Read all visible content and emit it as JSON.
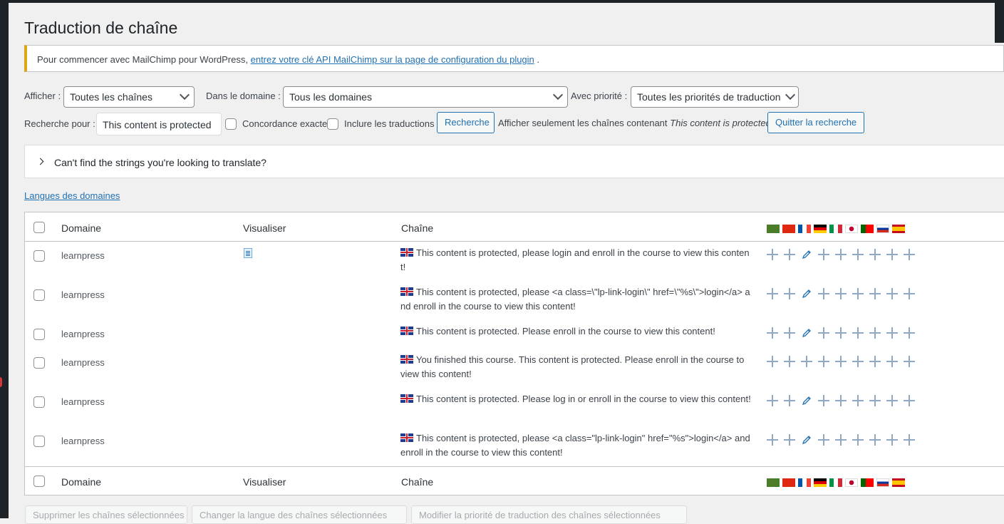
{
  "page": {
    "title": "Traduction de chaîne"
  },
  "notice": {
    "text": "Pour commencer avec MailChimp pour WordPress,",
    "link": "entrez votre clé API MailChimp sur la page de configuration du plugin",
    "suffix": "."
  },
  "filters": {
    "afficher_label": "Afficher :",
    "afficher_value": "Toutes les chaînes",
    "domaine_label": "Dans le domaine :",
    "domaine_value": "Tous les domaines",
    "priorite_label": "Avec priorité :",
    "priorite_value": "Toutes les priorités de traduction",
    "recherche_label": "Recherche pour :",
    "recherche_value": "This content is protected",
    "concordance_label": "Concordance exacte",
    "inclure_label": "Inclure les traductions",
    "recherche_button": "Recherche",
    "show_only_text": "Afficher seulement les chaînes contenant",
    "show_only_term": "This content is protected",
    "quit_button": "Quitter la recherche"
  },
  "accordion": {
    "text": "Can't find the strings you're looking to translate?"
  },
  "langues_link": "Langues des domaines",
  "table": {
    "col_domaine": "Domaine",
    "col_visualiser": "Visualiser",
    "col_chaine": "Chaîne",
    "flags": [
      "ar",
      "zh",
      "fr",
      "de",
      "it",
      "ja",
      "pt",
      "ru",
      "es"
    ],
    "rows": [
      {
        "domaine": "learnpress",
        "has_view": true,
        "chaine": "This content is protected, please login and enroll in the course to view this content!",
        "actions": [
          "plus",
          "plus",
          "pencil",
          "plus",
          "plus",
          "plus",
          "plus",
          "plus",
          "plus"
        ]
      },
      {
        "domaine": "learnpress",
        "has_view": false,
        "chaine": "This content is protected, please <a class=\\\"lp-link-login\\\" href=\\\"%s\\\">login</a> and enroll in the course to view this content!",
        "actions": [
          "plus",
          "plus",
          "pencil",
          "plus",
          "plus",
          "plus",
          "plus",
          "plus",
          "plus"
        ]
      },
      {
        "domaine": "learnpress",
        "has_view": false,
        "chaine": "This content is protected. Please enroll in the course to view this content!",
        "actions": [
          "plus",
          "plus",
          "pencil",
          "plus",
          "plus",
          "plus",
          "plus",
          "plus",
          "plus"
        ]
      },
      {
        "domaine": "learnpress",
        "has_view": false,
        "chaine": "You finished this course. This content is protected. Please enroll in the course to view this content!",
        "actions": [
          "plus",
          "plus",
          "plus",
          "plus",
          "plus",
          "plus",
          "plus",
          "plus",
          "plus"
        ]
      },
      {
        "domaine": "learnpress",
        "has_view": false,
        "chaine": "This content is protected. Please log in or enroll in the course to view this content!",
        "actions": [
          "plus",
          "plus",
          "pencil",
          "plus",
          "plus",
          "plus",
          "plus",
          "plus",
          "plus"
        ]
      },
      {
        "domaine": "learnpress",
        "has_view": false,
        "chaine": "This content is protected, please <a class=\"lp-link-login\" href=\"%s\">login</a> and enroll in the course to view this content!",
        "actions": [
          "plus",
          "plus",
          "pencil",
          "plus",
          "plus",
          "plus",
          "plus",
          "plus",
          "plus"
        ]
      }
    ]
  },
  "bulk": {
    "delete": "Supprimer les chaînes sélectionnées",
    "change_lang": "Changer la langue des chaînes sélectionnées",
    "change_priority": "Modifier la priorité de traduction des chaînes sélectionnées"
  }
}
